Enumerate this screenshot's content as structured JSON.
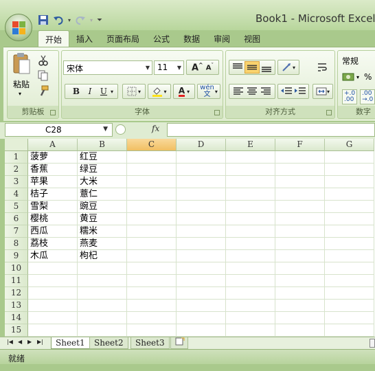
{
  "window": {
    "title": "Book1 - Microsoft Excel"
  },
  "tabs": [
    "开始",
    "插入",
    "页面布局",
    "公式",
    "数据",
    "审阅",
    "视图"
  ],
  "ribbon": {
    "clipboard": {
      "label": "剪贴板",
      "paste_label": "粘贴"
    },
    "font": {
      "label": "字体",
      "font_name": "宋体",
      "font_size": "11",
      "bold": "B",
      "italic": "I",
      "underline": "U",
      "grow": "A˄",
      "shrink": "A˅",
      "font_color": "A",
      "phonetic": "wén 文"
    },
    "alignment": {
      "label": "对齐方式"
    },
    "number": {
      "label": "数字",
      "format": "常规",
      "percent": "%",
      "inc_decimal": "+.0 .00",
      "dec_decimal": ".00 →.0"
    }
  },
  "formula_bar": {
    "name_box": "C28",
    "fx": "fx",
    "value": ""
  },
  "columns": [
    "A",
    "B",
    "C",
    "D",
    "E",
    "F",
    "G"
  ],
  "selected_column": "C",
  "rows": [
    [
      "菠萝",
      "红豆"
    ],
    [
      "香蕉",
      "绿豆"
    ],
    [
      "苹果",
      "大米"
    ],
    [
      "桔子",
      "薏仁"
    ],
    [
      "雪梨",
      "豌豆"
    ],
    [
      "樱桃",
      "黄豆"
    ],
    [
      "西瓜",
      "糯米"
    ],
    [
      "荔枝",
      "燕麦"
    ],
    [
      "木瓜",
      "枸杞"
    ],
    [
      "",
      ""
    ],
    [
      "",
      ""
    ],
    [
      "",
      ""
    ],
    [
      "",
      ""
    ],
    [
      "",
      ""
    ],
    [
      "",
      ""
    ]
  ],
  "row_numbers": [
    "1",
    "2",
    "3",
    "4",
    "5",
    "6",
    "7",
    "8",
    "9",
    "10",
    "11",
    "12",
    "13",
    "14",
    "15"
  ],
  "sheets": [
    "Sheet1",
    "Sheet2",
    "Sheet3"
  ],
  "active_sheet": "Sheet1",
  "status": {
    "text": "就绪"
  },
  "colors": {
    "frame": "#a9c98c",
    "selected_header": "#f1bf62",
    "grid_line": "#d7e3cc"
  },
  "icons": [
    "office-button-icon",
    "save-icon",
    "undo-icon",
    "redo-icon",
    "customize-qat-icon",
    "paste-icon",
    "cut-icon",
    "copy-icon",
    "format-painter-icon",
    "border-icon",
    "fill-color-icon",
    "font-color-icon",
    "align-top-icon",
    "align-middle-icon",
    "align-bottom-icon",
    "orientation-icon",
    "wrap-text-icon",
    "align-left-icon",
    "align-center-icon",
    "align-right-icon",
    "decrease-indent-icon",
    "increase-indent-icon",
    "merge-center-icon",
    "accounting-format-icon",
    "fx-icon",
    "sheet-nav-icon",
    "insert-sheet-icon"
  ]
}
